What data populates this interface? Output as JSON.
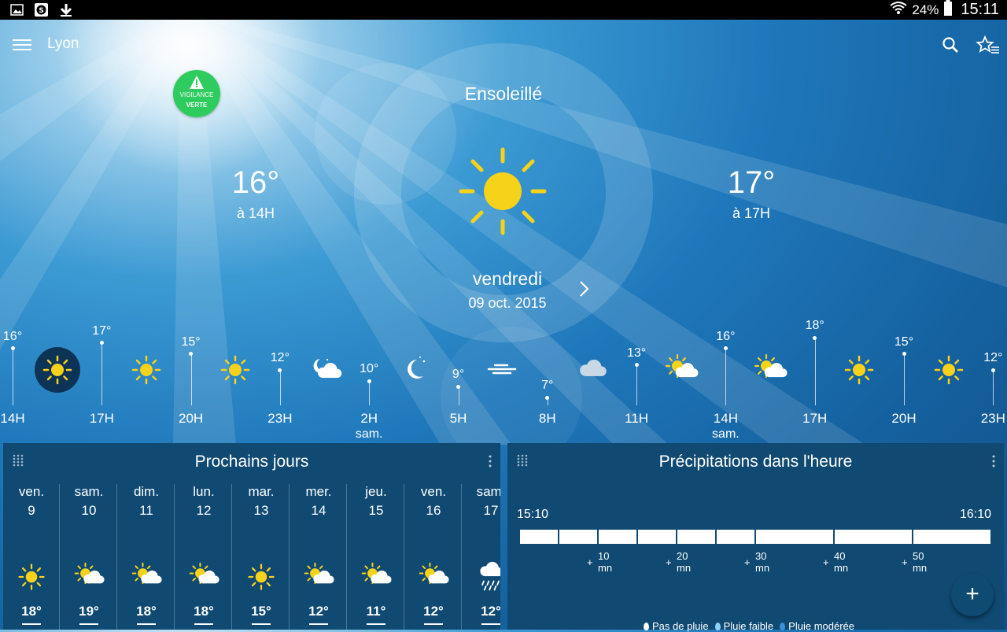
{
  "status_bar": {
    "battery": "24%",
    "time": "15:11"
  },
  "app_bar": {
    "city": "Lyon"
  },
  "vigilance": {
    "line1": "VIGILANCE",
    "line2": "VERTE",
    "color": "#2ecc5f"
  },
  "current": {
    "condition": "Ensoleillé",
    "left_temp": "16°",
    "left_time": "à 14H",
    "right_temp": "17°",
    "right_time": "à 17H",
    "day": "vendredi",
    "date": "09 oct. 2015",
    "icon": "sun-icon"
  },
  "hourly": {
    "hours": [
      {
        "temp": "16°",
        "hour": "14H",
        "sub": ""
      },
      {
        "temp": "17°",
        "hour": "17H",
        "sub": ""
      },
      {
        "temp": "15°",
        "hour": "20H",
        "sub": ""
      },
      {
        "temp": "12°",
        "hour": "23H",
        "sub": ""
      },
      {
        "temp": "10°",
        "hour": "2H",
        "sub": "sam."
      },
      {
        "temp": "9°",
        "hour": "5H",
        "sub": ""
      },
      {
        "temp": "7°",
        "hour": "8H",
        "sub": ""
      },
      {
        "temp": "13°",
        "hour": "11H",
        "sub": ""
      },
      {
        "temp": "16°",
        "hour": "14H",
        "sub": "sam."
      },
      {
        "temp": "18°",
        "hour": "17H",
        "sub": ""
      },
      {
        "temp": "15°",
        "hour": "20H",
        "sub": ""
      },
      {
        "temp": "12°",
        "hour": "23H",
        "sub": ""
      }
    ],
    "icons": [
      "sun-icon",
      "sun-icon",
      "sun-icon",
      "moon-cloud-icon",
      "moon-icon",
      "fog-icon",
      "cloud-icon",
      "sun-cloud-icon",
      "sun-cloud-icon",
      "sun-icon",
      "sun-icon"
    ]
  },
  "forecast_card": {
    "title": "Prochains jours",
    "days": [
      {
        "name": "ven.",
        "num": "9",
        "temp": "18°",
        "icon": "sun-icon"
      },
      {
        "name": "sam.",
        "num": "10",
        "temp": "19°",
        "icon": "sun-cloud-icon"
      },
      {
        "name": "dim.",
        "num": "11",
        "temp": "18°",
        "icon": "sun-cloud-icon"
      },
      {
        "name": "lun.",
        "num": "12",
        "temp": "18°",
        "icon": "sun-cloud-icon"
      },
      {
        "name": "mar.",
        "num": "13",
        "temp": "15°",
        "icon": "sun-icon"
      },
      {
        "name": "mer.",
        "num": "14",
        "temp": "12°",
        "icon": "sun-cloud-icon"
      },
      {
        "name": "jeu.",
        "num": "15",
        "temp": "11°",
        "icon": "sun-cloud-icon"
      },
      {
        "name": "ven.",
        "num": "16",
        "temp": "12°",
        "icon": "sun-cloud-icon"
      },
      {
        "name": "sam.",
        "num": "17",
        "temp": "12°",
        "icon": "rain-cloud-icon"
      }
    ]
  },
  "precip_card": {
    "title": "Précipitations dans l'heure",
    "start": "15:10",
    "end": "16:10",
    "ticks": [
      {
        "plus": "+",
        "num": "10",
        "unit": "mn"
      },
      {
        "plus": "+",
        "num": "20",
        "unit": "mn"
      },
      {
        "plus": "+",
        "num": "30",
        "unit": "mn"
      },
      {
        "plus": "+",
        "num": "40",
        "unit": "mn"
      },
      {
        "plus": "+",
        "num": "50",
        "unit": "mn"
      }
    ],
    "legend": [
      {
        "label": "Pas de pluie",
        "color": "#ffffff"
      },
      {
        "label": "Pluie faible",
        "color": "#8fd0f5"
      },
      {
        "label": "Pluie modérée",
        "color": "#3d8fd6"
      }
    ]
  },
  "fab": {
    "label": "+"
  }
}
